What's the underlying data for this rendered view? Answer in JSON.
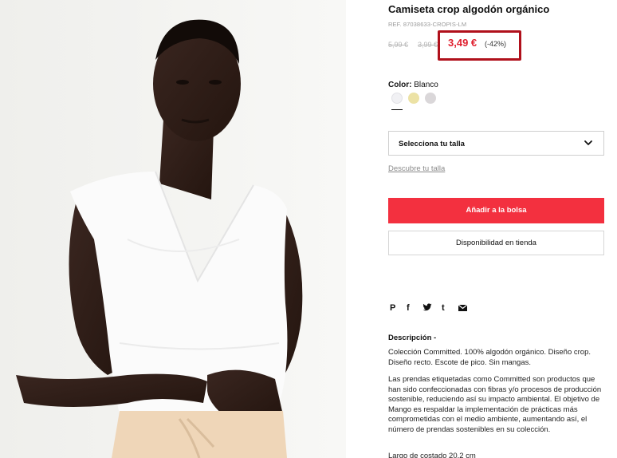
{
  "product": {
    "title": "Camiseta crop algodón orgánico",
    "reference": "REF. 87038633-CROPIS-LM",
    "original_price": "5,99 €",
    "previous_price": "3,99 €",
    "sale_price": "3,49 €",
    "discount": "(-42%)"
  },
  "colors": {
    "label": "Color:",
    "selected": "Blanco",
    "swatches": [
      "#f1f1f4",
      "#ece2a5",
      "#dad7d9"
    ]
  },
  "size": {
    "placeholder": "Selecciona tu talla",
    "guide_link": "Descubre tu talla"
  },
  "actions": {
    "add_to_bag": "Añadir a la bolsa",
    "store_availability": "Disponibilidad en tienda"
  },
  "share": {
    "icons": [
      "pinterest-icon",
      "facebook-icon",
      "twitter-icon",
      "tumblr-icon",
      "email-icon"
    ],
    "labels": {
      "pinterest": "P",
      "facebook": "f",
      "tumblr": "t"
    }
  },
  "description": {
    "title": "Descripción -",
    "paragraph1": "Colección Committed. 100% algodón orgánico. Diseño crop. Diseño recto. Escote de pico. Sin mangas.",
    "paragraph2": "Las prendas etiquetadas como Committed son productos que han sido confeccionadas con fibras y/o procesos de producción sostenible, reduciendo así su impacto ambiental. El objetivo de Mango es respaldar la implementación de prácticas más comprometidas con el medio ambiente, aumentando así, el número de prendas sostenibles en su colección.",
    "paragraph3": "Largo de costado 20,2 cm"
  },
  "colors_theme": {
    "accent_red": "#f3303f",
    "sale_red": "#e0202f",
    "highlight_border": "#b0101b"
  }
}
